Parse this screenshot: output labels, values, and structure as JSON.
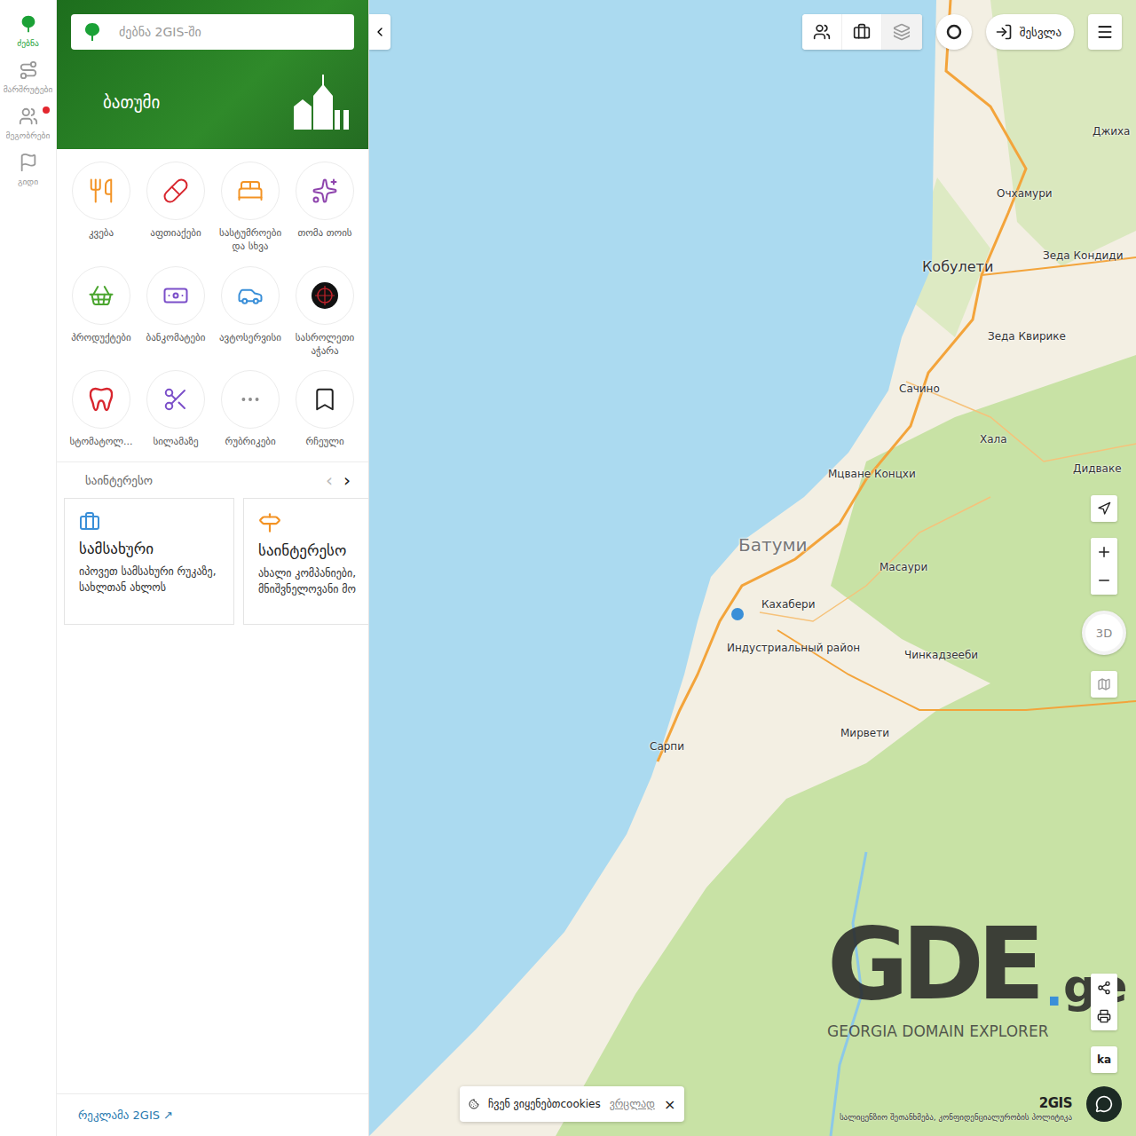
{
  "rail": [
    {
      "label": "ძებნა",
      "selected": true,
      "badge": false
    },
    {
      "label": "მარშრუტები",
      "selected": false,
      "badge": false
    },
    {
      "label": "მეგობრები",
      "selected": false,
      "badge": true
    },
    {
      "label": "გიდი",
      "selected": false,
      "badge": false
    }
  ],
  "search": {
    "placeholder": "ძებნა 2GIS-ში"
  },
  "banner": {
    "title": "ბათუმი"
  },
  "categories": [
    {
      "label": "კვება",
      "color": "#f39325"
    },
    {
      "label": "აფთიაქები",
      "color": "#d8262e"
    },
    {
      "label": "სასტუმროები და სხვა",
      "color": "#f39325"
    },
    {
      "label": "თომა თოის",
      "color": "#8e44ad"
    },
    {
      "label": "პროდუქტები",
      "color": "#4aa52e"
    },
    {
      "label": "ბანკომატები",
      "color": "#7b4fc9"
    },
    {
      "label": "ავტოსერვისი",
      "color": "#3a8fd8"
    },
    {
      "label": "სასროლეთი აჭარა",
      "color": "#111111"
    },
    {
      "label": "სტომატოლ...",
      "color": "#d8262e"
    },
    {
      "label": "სილამაზე",
      "color": "#7b4fc9"
    },
    {
      "label": "რუბრიკები",
      "color": "#8a8a8a"
    },
    {
      "label": "რჩეული",
      "color": "#222222"
    }
  ],
  "section": {
    "title": "საინტერესო",
    "prev": "‹",
    "next": "›"
  },
  "cards": [
    {
      "title": "სამსახური",
      "text": "იპოვეთ სამსახური რუკაზე, სახლთან ახლოს",
      "color": "#3a8fd8"
    },
    {
      "title": "საინტერესო",
      "text": "ახალი კომპანიები, მნიშვნელოვანი მო",
      "color": "#f39325"
    }
  ],
  "footer": {
    "link": "რეკლამა 2GIS ↗"
  },
  "top_controls": {
    "login": "შესვლა"
  },
  "map_controls": {
    "view3d": "3D",
    "language": "ka"
  },
  "map_labels": [
    {
      "text": "Джиха",
      "kind": "village"
    },
    {
      "text": "Очхамури",
      "kind": "village"
    },
    {
      "text": "Кобулети",
      "kind": "town"
    },
    {
      "text": "Зеда Кондиди",
      "kind": "village"
    },
    {
      "text": "Зеда Квирике",
      "kind": "village"
    },
    {
      "text": "Сачино",
      "kind": "village"
    },
    {
      "text": "Хала",
      "kind": "village"
    },
    {
      "text": "Дидваке",
      "kind": "village"
    },
    {
      "text": "Мцване Концхи",
      "kind": "village"
    },
    {
      "text": "Батуми",
      "kind": "city"
    },
    {
      "text": "Масаури",
      "kind": "village"
    },
    {
      "text": "Кахабери",
      "kind": "village"
    },
    {
      "text": "Индустриальный район",
      "kind": "village"
    },
    {
      "text": "Чинкадзееби",
      "kind": "village"
    },
    {
      "text": "Мирвети",
      "kind": "village"
    },
    {
      "text": "Сарпи",
      "kind": "village"
    }
  ],
  "watermark": {
    "big": "GDE",
    "dot": ".",
    "tld": "ge",
    "subtitle": "GEORGIA DOMAIN EXPLORER"
  },
  "brand": {
    "logo": "2GIS",
    "legal": "სალიცენზიო შეთანხმება, კონფიდენციალურობის პოლიტიკა"
  },
  "cookie": {
    "text": "ჩვენ ვიყენებთcookies",
    "link": "ვრცლად",
    "close": "×"
  }
}
